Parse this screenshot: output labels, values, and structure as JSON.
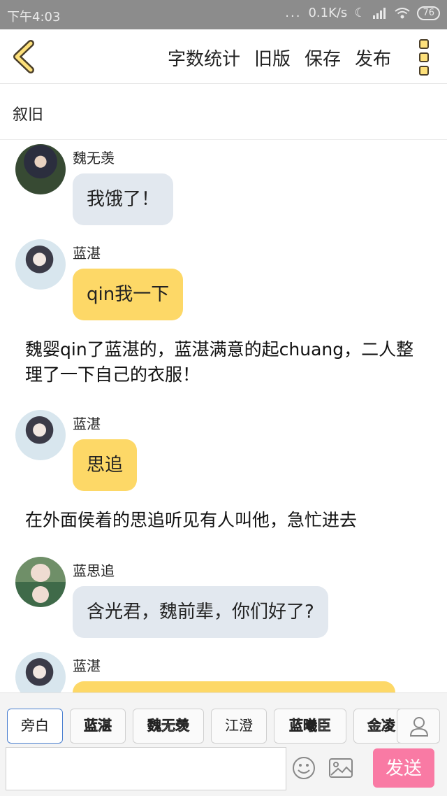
{
  "status_bar": {
    "time": "下午4:03",
    "dots": "...",
    "network_speed": "0.1K/s",
    "battery": "76"
  },
  "toolbar": {
    "word_count": "字数统计",
    "old_version": "旧版",
    "save": "保存",
    "publish": "发布"
  },
  "story_title": "叙旧",
  "messages": [
    {
      "name": "魏无羡",
      "text": "我饿了！"
    },
    {
      "name": "蓝湛",
      "text": "qin我一下"
    },
    {
      "text": "魏婴qin了蓝湛的，蓝湛满意的起chuang，二人整理了一下自己的衣服！"
    },
    {
      "name": "蓝湛",
      "text": "思追"
    },
    {
      "text": "在外面侯着的思追听见有人叫他，急忙进去"
    },
    {
      "name": "蓝思追",
      "text": "含光君，魏前辈，你们好了?"
    },
    {
      "name": "蓝湛",
      "text": ""
    }
  ],
  "character_tabs": [
    "旁白",
    "蓝湛",
    "魏无羡",
    "江澄",
    "蓝曦臣",
    "金凌"
  ],
  "input": {
    "value": "",
    "placeholder": ""
  },
  "send_label": "发送",
  "colors": {
    "accent_yellow": "#fdd867",
    "bubble_grey": "#e2e8ef",
    "send_pink": "#f97aa4",
    "back_arrow": "#fde07a"
  }
}
